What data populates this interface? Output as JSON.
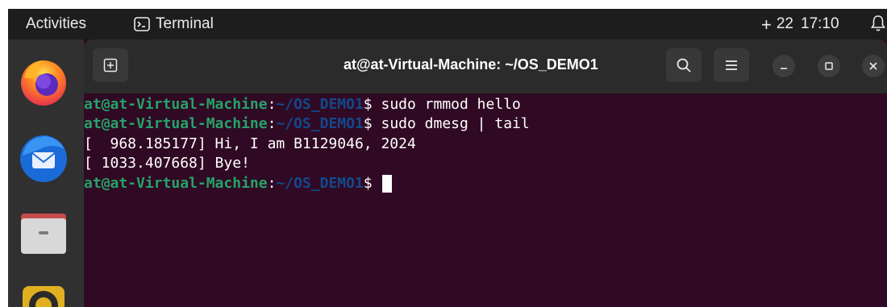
{
  "topbar": {
    "activities": "Activities",
    "app_name": "Terminal",
    "workspace_plus": "+",
    "workspace_number": "22",
    "clock": "17:10"
  },
  "dock": {
    "items": [
      {
        "name": "firefox-icon"
      },
      {
        "name": "thunderbird-icon"
      },
      {
        "name": "files-icon"
      },
      {
        "name": "rhythmbox-icon"
      }
    ]
  },
  "window": {
    "title": "at@at-Virtual-Machine: ~/OS_DEMO1"
  },
  "terminal": {
    "lines": [
      {
        "type": "prompt",
        "user": "at@at-Virtual-Machine",
        "colon": ":",
        "path": "~/OS_DEMO1",
        "dollar": "$",
        "cmd": " sudo rmmod hello"
      },
      {
        "type": "prompt",
        "user": "at@at-Virtual-Machine",
        "colon": ":",
        "path": "~/OS_DEMO1",
        "dollar": "$",
        "cmd": " sudo dmesg | tail"
      },
      {
        "type": "output",
        "text": "[  968.185177] Hi, I am B1129046, 2024"
      },
      {
        "type": "output",
        "text": "[ 1033.407668] Bye!"
      },
      {
        "type": "prompt",
        "user": "at@at-Virtual-Machine",
        "colon": ":",
        "path": "~/OS_DEMO1",
        "dollar": "$",
        "cmd": " "
      }
    ]
  },
  "colors": {
    "terminal_bg": "#300a24",
    "prompt_user": "#26a269",
    "prompt_path": "#12488b",
    "headerbar": "#2b2b2b",
    "topbar": "#1d1d1d"
  }
}
